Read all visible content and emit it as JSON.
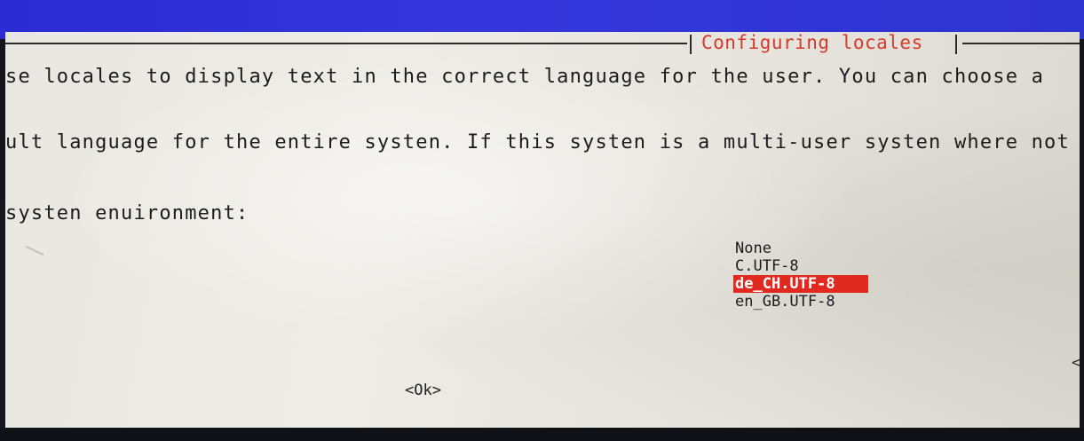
{
  "dialog": {
    "title": "Configuring locales",
    "line1": "se locales to display text in the correct language for the user. You can choose a",
    "line2": "ult language for the entire systen. If this systen is a multi-user systen where not",
    "prompt": "systen enuironment:",
    "options": [
      "None",
      "C.UTF-8",
      "de_CH.UTF-8",
      "en_GB.UTF-8"
    ],
    "selected_index": 2,
    "ok_label": "<Ok>",
    "cancel_label_partial": "<C"
  },
  "colors": {
    "title": "#d43a2c",
    "selection_bg": "#e0291f",
    "dialog_bg": "#e9e7e1",
    "top_bar": "#3436dc"
  }
}
